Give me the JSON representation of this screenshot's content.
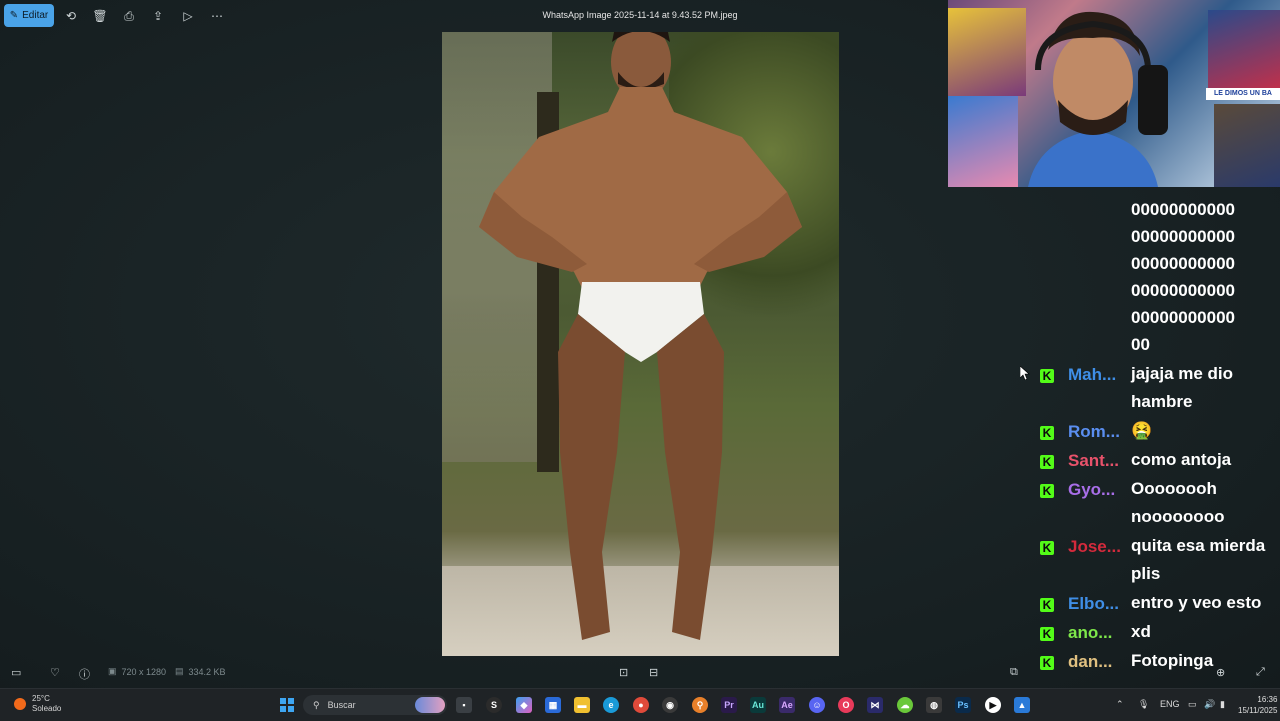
{
  "viewer": {
    "edit_label": "Editar",
    "file_title": "WhatsApp Image 2025-11-14 at 9.43.52 PM.jpeg",
    "dimensions": "720 x 1280",
    "file_size": "334.2 KB"
  },
  "chat": {
    "spam_lines": [
      "00000000000",
      "00000000000",
      "00000000000",
      "00000000000",
      "00000000000",
      "00"
    ],
    "messages": [
      {
        "user": "Mah...",
        "color": "#3f8ee6",
        "text": "jajaja me dio hambre"
      },
      {
        "user": "Rom...",
        "color": "#5a8ef0",
        "text": "🤮"
      },
      {
        "user": "Sant...",
        "color": "#e8526b",
        "text": "como antoja"
      },
      {
        "user": "Gyo...",
        "color": "#a86ee8",
        "text": "Oooooooh noooooooo"
      },
      {
        "user": "Jose...",
        "color": "#d42a3c",
        "text": "quita esa mierda plis"
      },
      {
        "user": "Elbo...",
        "color": "#3f8ee6",
        "text": "entro y veo esto"
      },
      {
        "user": "ano...",
        "color": "#7ee84a",
        "text": "xd"
      },
      {
        "user": "dan...",
        "color": "#e0c080",
        "text": "Fotopinga"
      }
    ]
  },
  "taskbar": {
    "temperature": "25°C",
    "weather": "Soleado",
    "search_placeholder": "Buscar",
    "language": "ENG",
    "time": "16:36",
    "date": "15/11/2025"
  },
  "webcam": {
    "poster_text": "LE DIMOS UN BA"
  }
}
